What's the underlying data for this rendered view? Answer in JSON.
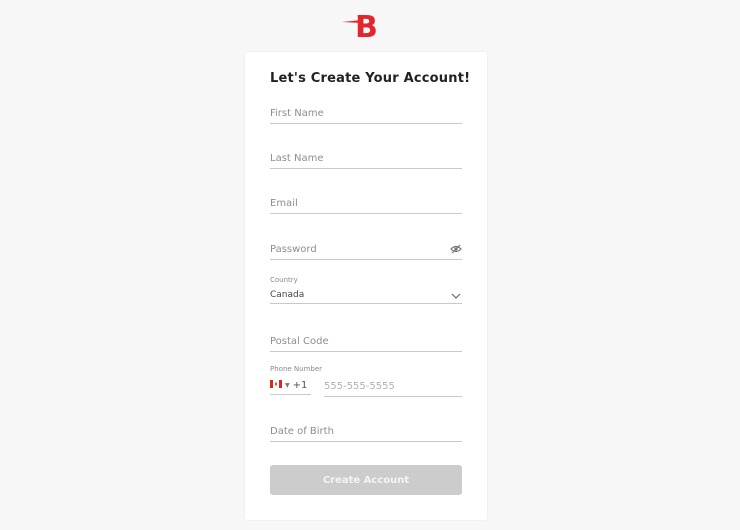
{
  "brand": {
    "logo_letter": "B",
    "color": "#e3262e"
  },
  "form": {
    "title": "Let's Create Your Account!",
    "first_name": {
      "placeholder": "First Name",
      "value": ""
    },
    "last_name": {
      "placeholder": "Last Name",
      "value": ""
    },
    "email": {
      "placeholder": "Email",
      "value": ""
    },
    "password": {
      "placeholder": "Password",
      "value": "",
      "toggle_icon": "eye-off-icon"
    },
    "country": {
      "label": "Country",
      "value": "Canada",
      "icon": "chevron-down-icon"
    },
    "postal_code": {
      "placeholder": "Postal Code",
      "value": ""
    },
    "phone": {
      "label": "Phone Number",
      "country_flag": "canada-flag",
      "dial_code": "+1",
      "placeholder": "555-555-5555",
      "value": ""
    },
    "dob": {
      "placeholder": "Date of Birth",
      "value": ""
    },
    "submit_label": "Create Account",
    "submit_color": "#cccccc"
  }
}
